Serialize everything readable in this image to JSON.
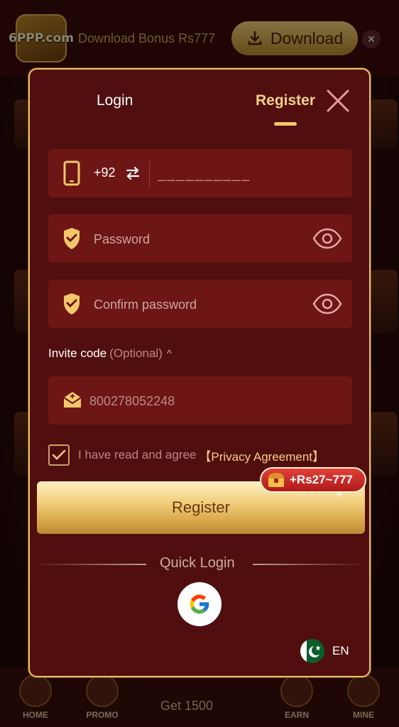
{
  "background": {
    "banner": {
      "logo_text": "6PPP.com",
      "text": "Download Bonus Rs777",
      "download_label": "Download",
      "close_icon": "close-icon"
    },
    "bottom_nav": {
      "items": [
        {
          "label": "HOME",
          "icon": "home-icon"
        },
        {
          "label": "PROMO",
          "icon": "promo-icon"
        },
        {
          "label": "Get 1500",
          "icon": "wheel-icon"
        },
        {
          "label": "EARN",
          "icon": "gift-icon"
        },
        {
          "label": "MINE",
          "icon": "mine-icon"
        }
      ]
    }
  },
  "modal": {
    "tabs": [
      {
        "label": "Login",
        "active": false
      },
      {
        "label": "Register",
        "active": true
      }
    ],
    "phone": {
      "country_code": "+92",
      "placeholder": "__________"
    },
    "password": {
      "placeholder": "Password"
    },
    "confirm_password": {
      "placeholder": "Confirm password"
    },
    "invite": {
      "label": "Invite code",
      "optional": "(Optional)",
      "chevron": "^",
      "value": "800278052248"
    },
    "agreement": {
      "checked": true,
      "text": "I have read and agree",
      "link": "【Privacy Agreement】"
    },
    "register_button": "Register",
    "bonus_badge": "+Rs27~777",
    "quick_login_label": "Quick Login",
    "language": "EN"
  },
  "colors": {
    "modal_bg": "#510e0e",
    "field_bg": "#6e1515",
    "gold": "#f2d08a",
    "border": "#e6c06a"
  }
}
